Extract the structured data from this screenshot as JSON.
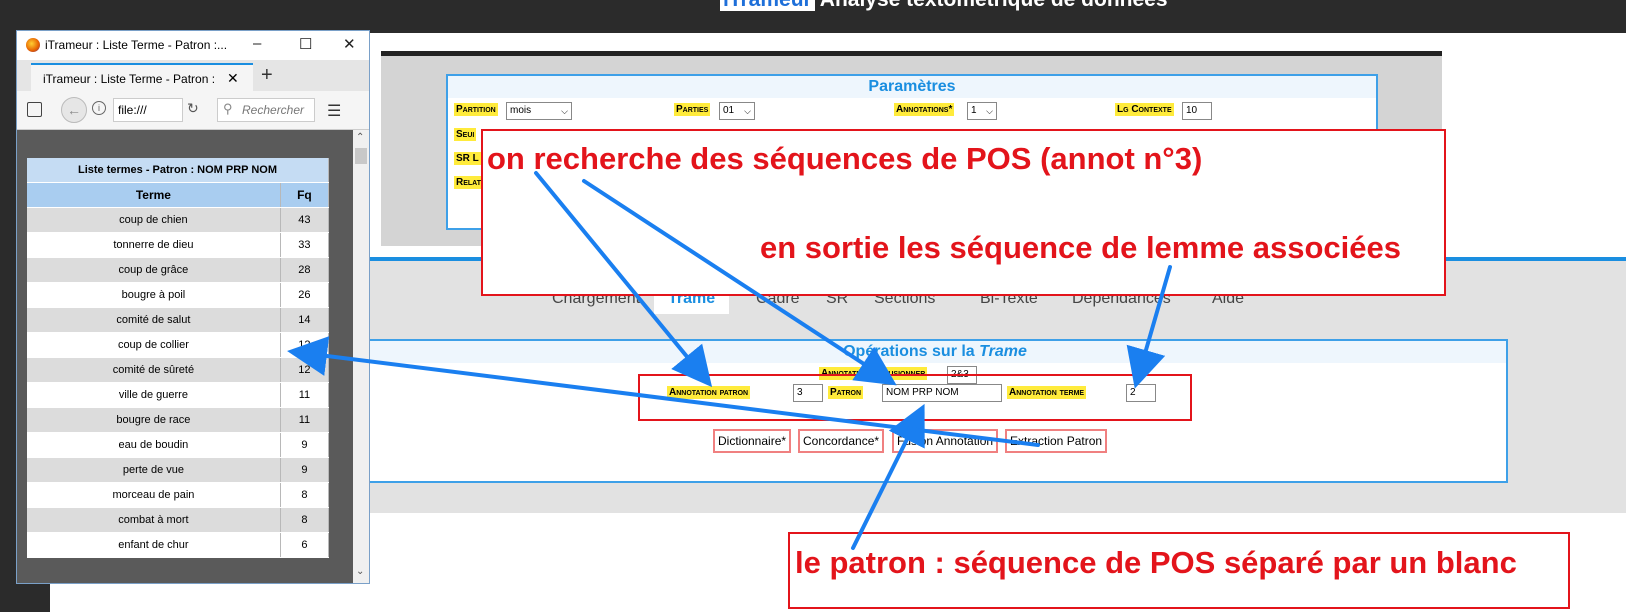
{
  "app": {
    "brand": "iTrameur",
    "title_rest": " Analyse textométrique de données"
  },
  "params": {
    "title": "Paramètres",
    "partition_label": "Partition",
    "partition_value": "mois",
    "parties_label": "Parties",
    "parties_value": "01",
    "annotations_label": "Annotations*",
    "annotations_value": "1",
    "lg_contexte_label": "Lg Contexte",
    "lg_contexte_value": "10",
    "seuil_label": "Seui",
    "sr_label": "SR L",
    "relat_label": "Relat"
  },
  "trame": {
    "tabs": [
      "Chargement",
      "Trame",
      "Cadre",
      "SR",
      "Sections",
      "Bi-Texte",
      "Dépendances",
      "Aide"
    ],
    "ops_title_prefix": "Opérations sur la ",
    "ops_title_italic": "Trame",
    "fusion_label": "Annotations à fusionner",
    "fusion_value": "2&3",
    "annot_patron_label": "Annotation patron",
    "annot_patron_value": "3",
    "patron_label": "Patron",
    "patron_value": "NOM PRP NOM",
    "annot_terme_label": "Annotation terme",
    "annot_terme_value": "2",
    "buttons": [
      "Dictionnaire*",
      "Concordance*",
      "Fusion Annotation",
      "Extraction Patron"
    ]
  },
  "callouts": {
    "c1": "on recherche des séquences de POS (annot n°3)",
    "c2": "en sortie les séquence de lemme associées",
    "c3": "le patron : séquence de POS séparé par un blanc"
  },
  "browser": {
    "window_title": "iTrameur : Liste Terme - Patron :...",
    "tab_label": "iTrameur : Liste Terme - Patron :",
    "url": "file:///",
    "search_placeholder": "Rechercher"
  },
  "table": {
    "title": "Liste termes - Patron : NOM PRP NOM",
    "col_terme": "Terme",
    "col_fq": "Fq",
    "rows": [
      {
        "terme": "coup de chien",
        "fq": "43"
      },
      {
        "terme": "tonnerre de dieu",
        "fq": "33"
      },
      {
        "terme": "coup de grâce",
        "fq": "28"
      },
      {
        "terme": "bougre à poil",
        "fq": "26"
      },
      {
        "terme": "comité de salut",
        "fq": "14"
      },
      {
        "terme": "coup de collier",
        "fq": "12"
      },
      {
        "terme": "comité de sûreté",
        "fq": "12"
      },
      {
        "terme": "ville de guerre",
        "fq": "11"
      },
      {
        "terme": "bougre de race",
        "fq": "11"
      },
      {
        "terme": "eau de boudin",
        "fq": "9"
      },
      {
        "terme": "perte de vue",
        "fq": "9"
      },
      {
        "terme": "morceau de pain",
        "fq": "8"
      },
      {
        "terme": "combat à mort",
        "fq": "8"
      },
      {
        "terme": "enfant de chur",
        "fq": "6"
      }
    ]
  },
  "colors": {
    "accent": "#1a8ee0",
    "callout_red": "#e3141b",
    "label_yellow": "#ffeb3b",
    "arrow_blue": "#1a7ff0"
  }
}
